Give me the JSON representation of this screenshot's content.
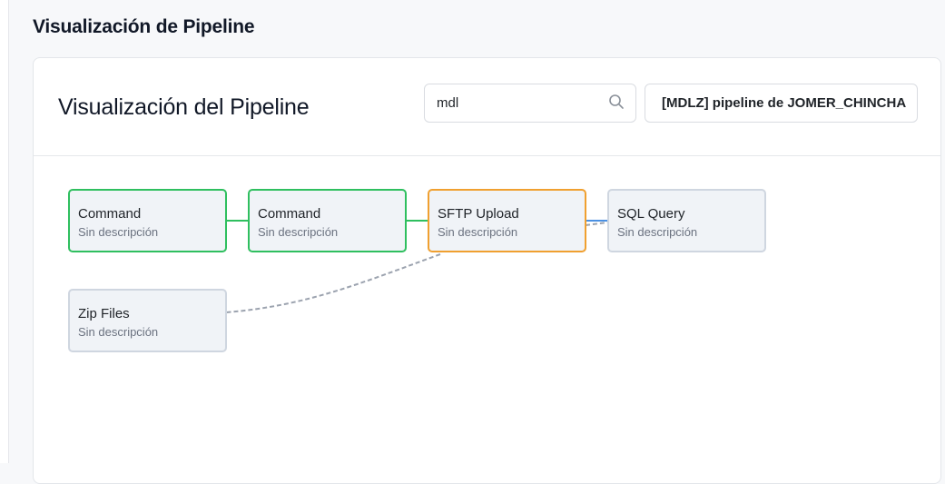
{
  "page": {
    "title": "Visualización de Pipeline"
  },
  "card": {
    "title": "Visualización del Pipeline",
    "search": {
      "value": "mdl",
      "icon": "search-icon"
    },
    "pipeline_select": {
      "value": "[MDLZ] pipeline de JOMER_CHINCHA"
    }
  },
  "colors": {
    "success": "#2fbf5f",
    "running": "#f0a030",
    "idle": "#cfd6e0",
    "edge_active": "#4a90e2",
    "edge_dashed": "#9ca3af"
  },
  "nodes": [
    {
      "title": "Command",
      "description": "Sin descripción",
      "status": "success"
    },
    {
      "title": "Command",
      "description": "Sin descripción",
      "status": "success"
    },
    {
      "title": "SFTP Upload",
      "description": "Sin descripción",
      "status": "running"
    },
    {
      "title": "SQL Query",
      "description": "Sin descripción",
      "status": "idle"
    },
    {
      "title": "Zip Files",
      "description": "Sin descripción",
      "status": "idle"
    }
  ]
}
